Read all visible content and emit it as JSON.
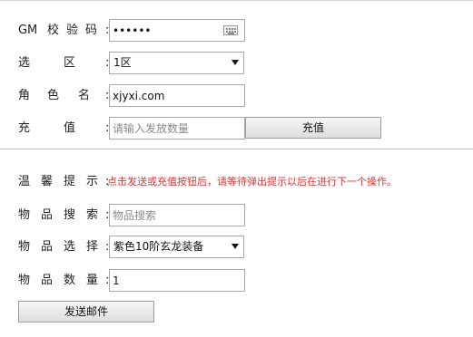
{
  "form": {
    "gm_code": {
      "label": [
        "G",
        "M",
        "校",
        "验",
        "码"
      ],
      "colon": ":",
      "value": "••••••"
    },
    "server": {
      "label": [
        "选",
        "区"
      ],
      "colon": ":",
      "selected": "1区"
    },
    "role": {
      "label": [
        "角",
        "色",
        "名"
      ],
      "colon": ":",
      "value": "xjyxi.com"
    },
    "recharge": {
      "label": [
        "充",
        "值"
      ],
      "colon": ":",
      "placeholder": "请输入发放数量",
      "button": "充值"
    }
  },
  "mail": {
    "tip": {
      "label": [
        "温",
        "馨",
        "提",
        "示"
      ],
      "colon": ":",
      "text": "点击发送或充值按钮后，请等待弹出提示以后在进行下一个操作。"
    },
    "item_search": {
      "label": [
        "物",
        "品",
        "搜",
        "索"
      ],
      "colon": ":",
      "placeholder": "物品搜索"
    },
    "item_select": {
      "label": [
        "物",
        "品",
        "选",
        "择"
      ],
      "colon": ":",
      "selected": "紫色10阶玄龙装备"
    },
    "item_qty": {
      "label": [
        "物",
        "品",
        "数",
        "量"
      ],
      "colon": ":",
      "value": "1"
    },
    "send_button": "发送邮件"
  },
  "colors": {
    "tip_text": "#e23232",
    "divider": "#b8b8b8"
  },
  "icons": {
    "keyboard": "keyboard-icon",
    "dropdown": "chevron-down-icon"
  }
}
